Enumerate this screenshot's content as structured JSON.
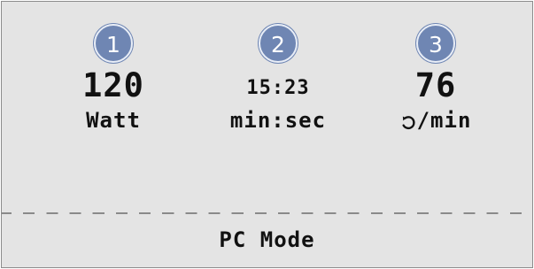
{
  "metrics": [
    {
      "badge": "1",
      "value": "120",
      "unit": "Watt"
    },
    {
      "badge": "2",
      "value": "15:23",
      "unit": "min:sec"
    },
    {
      "badge": "3",
      "value": "76",
      "unit_icon": "rotation-icon",
      "unit": "/min"
    }
  ],
  "mode": {
    "label": "PC Mode"
  },
  "colors": {
    "background": "#e4e4e4",
    "badge": "#6f86b3",
    "text": "#111111",
    "divider": "#8a8a8a"
  }
}
